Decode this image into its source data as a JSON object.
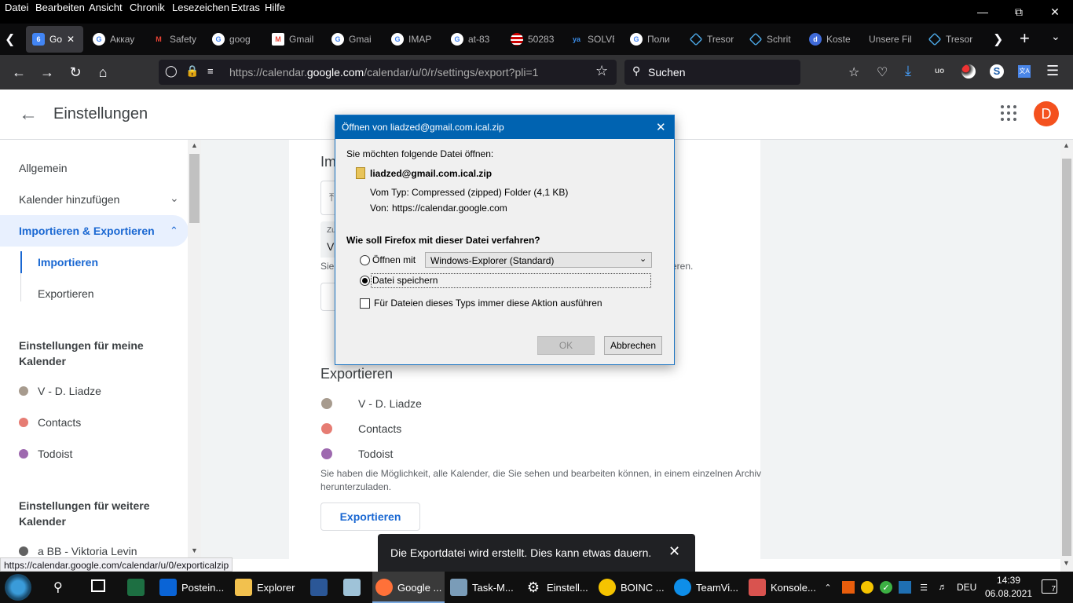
{
  "menubar": {
    "items": [
      "Datei",
      "Bearbeiten",
      "Ansicht",
      "Chronik",
      "Lesezeichen",
      "Extras",
      "Hilfe"
    ]
  },
  "tabs": [
    {
      "label": "Go",
      "active": true,
      "icon": "google-calendar-icon"
    },
    {
      "label": "Аккау",
      "icon": "google-icon"
    },
    {
      "label": "Safety",
      "icon": "gmail-icon"
    },
    {
      "label": "goog",
      "icon": "google-icon"
    },
    {
      "label": "Gmail",
      "icon": "gmail-icon"
    },
    {
      "label": "Gmai",
      "icon": "google-icon"
    },
    {
      "label": "IMAP",
      "icon": "google-icon"
    },
    {
      "label": "at-83",
      "icon": "google-icon"
    },
    {
      "label": "50283",
      "icon": "flag-icon"
    },
    {
      "label": "SOLVE",
      "icon": "ya-icon"
    },
    {
      "label": "Поли",
      "icon": "google-icon"
    },
    {
      "label": "Tresor",
      "icon": "tresor-icon"
    },
    {
      "label": "Schrit",
      "icon": "tresor-icon"
    },
    {
      "label": "Koste",
      "icon": "d-icon"
    },
    {
      "label": "Unsere Fil",
      "icon": "none"
    },
    {
      "label": "Tresor",
      "icon": "tresor-icon"
    }
  ],
  "url": {
    "prefix": "https://calendar.",
    "domain": "google.com",
    "path": "/calendar/u/0/r/settings/export?pli=1"
  },
  "search": {
    "placeholder": "Suchen"
  },
  "header": {
    "title": "Einstellungen",
    "avatar": "D"
  },
  "sidebar": {
    "items": [
      {
        "label": "Allgemein"
      },
      {
        "label": "Kalender hinzufügen"
      },
      {
        "label": "Importieren & Exportieren"
      },
      {
        "label": "Importieren"
      },
      {
        "label": "Exportieren"
      }
    ],
    "section_my": "Einstellungen für meine Kalender",
    "my_calendars": [
      {
        "label": "V - D. Liadze",
        "color": "#a79b8e"
      },
      {
        "label": "Contacts",
        "color": "#e67c73"
      },
      {
        "label": "Todoist",
        "color": "#9e69af"
      }
    ],
    "section_other": "Einstellungen für weitere Kalender",
    "other_calendars": [
      {
        "label": "a BB - Viktoria Levin",
        "color": "#616161"
      }
    ]
  },
  "content": {
    "import_heading_fragment": "Im",
    "file_field_label": "Zu",
    "file_field_value": "V",
    "hint_fragment": "Sie",
    "hint_end": "tieren.",
    "export_heading": "Exportieren",
    "export_calendars": [
      {
        "label": "V - D. Liadze",
        "color": "#a79b8e"
      },
      {
        "label": "Contacts",
        "color": "#e67c73"
      },
      {
        "label": "Todoist",
        "color": "#9e69af"
      }
    ],
    "export_desc_1": "Sie haben die Möglichkeit, alle Kalender, die Sie sehen und bearbeiten können, in einem einzelnen Archiv",
    "export_desc_2": "herunterzuladen.",
    "export_button": "Exportieren"
  },
  "dialog": {
    "title": "Öffnen von liadzed@gmail.com.ical.zip",
    "intro": "Sie möchten folgende Datei öffnen:",
    "filename": "liadzed@gmail.com.ical.zip",
    "type_label": "Vom Typ:",
    "type_value": "Compressed (zipped) Folder (4,1 KB)",
    "from_label": "Von:",
    "from_value": "https://calendar.google.com",
    "question": "Wie soll Firefox mit dieser Datei verfahren?",
    "open_with_label": "Öffnen mit",
    "open_with_value": "Windows-Explorer (Standard)",
    "save_label": "Datei speichern",
    "always_label": "Für Dateien dieses Typs immer diese Aktion ausführen",
    "ok": "OK",
    "cancel": "Abbrechen"
  },
  "snackbar": {
    "text": "Die Exportdatei wird erstellt. Dies kann etwas dauern."
  },
  "statusbar": {
    "url": "https://calendar.google.com/calendar/u/0/exporticalzip"
  },
  "taskbar": {
    "items": [
      {
        "label": "",
        "icon": "excel-icon",
        "color": "#1d6f42"
      },
      {
        "label": "Postein...",
        "icon": "outlook-icon",
        "color": "#0a64d6"
      },
      {
        "label": "Explorer",
        "icon": "folder-icon",
        "color": "#f2c14e"
      },
      {
        "label": "",
        "icon": "word-icon",
        "color": "#2b5797"
      },
      {
        "label": "",
        "icon": "notepad-icon",
        "color": "#9fc3d8"
      },
      {
        "label": "Google ...",
        "icon": "firefox-icon",
        "color": "#ff7139"
      },
      {
        "label": "Task-M...",
        "icon": "task-manager-icon",
        "color": "#7a9cb8"
      },
      {
        "label": "Einstell...",
        "icon": "settings-gear-icon",
        "color": "#ffffff"
      },
      {
        "label": "BOINC ...",
        "icon": "boinc-icon",
        "color": "#f5c400"
      },
      {
        "label": "TeamVi...",
        "icon": "teamviewer-icon",
        "color": "#0e8ee9"
      },
      {
        "label": "Konsole...",
        "icon": "console-icon",
        "color": "#d9534f"
      }
    ],
    "lang": "DEU",
    "time": "14:39",
    "date": "06.08.2021",
    "notifications": "7"
  }
}
